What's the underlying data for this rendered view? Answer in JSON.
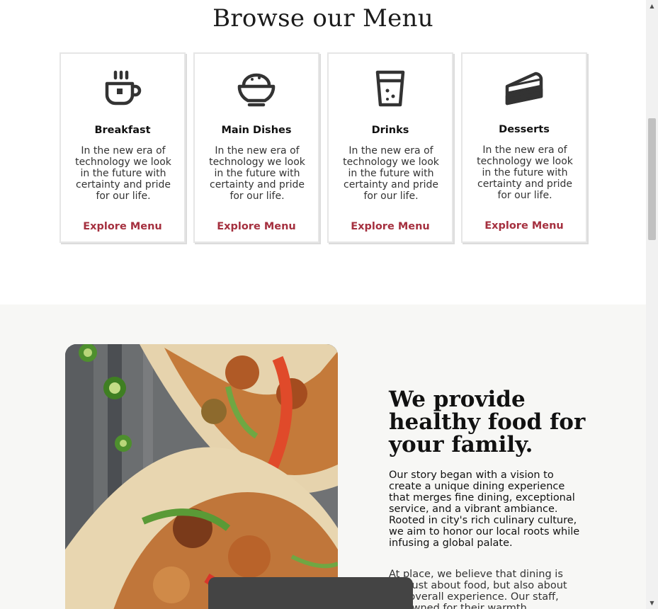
{
  "menu": {
    "title": "Browse our Menu",
    "cards": [
      {
        "title": "Breakfast",
        "desc": "In the new era of technology we look in the future with certainty and pride for our life.",
        "link": "Explore Menu",
        "icon": "coffee-cup-icon"
      },
      {
        "title": "Main Dishes",
        "desc": "In the new era of technology we look in the future with certainty and pride for our life.",
        "link": "Explore Menu",
        "icon": "rice-bowl-icon"
      },
      {
        "title": "Drinks",
        "desc": "In the new era of technology we look in the future with certainty and pride for our life.",
        "link": "Explore Menu",
        "icon": "glass-icon"
      },
      {
        "title": "Desserts",
        "desc": "In the new era of technology we look in the future with certainty and pride for our life.",
        "link": "Explore Menu",
        "icon": "cake-slice-icon"
      }
    ],
    "accent_color": "#a5303f"
  },
  "story": {
    "heading": "We provide healthy food for your family.",
    "paragraph1": "Our story began with a vision to create a unique dining experience that merges fine dining, exceptional service, and a vibrant ambiance. Rooted in city's rich culinary culture, we aim to honor our local roots while infusing a global palate.",
    "paragraph2": "At place, we believe that dining is not just about food, but also about the overall experience. Our staff, renowned for their warmth",
    "image": "tacos-photo"
  }
}
